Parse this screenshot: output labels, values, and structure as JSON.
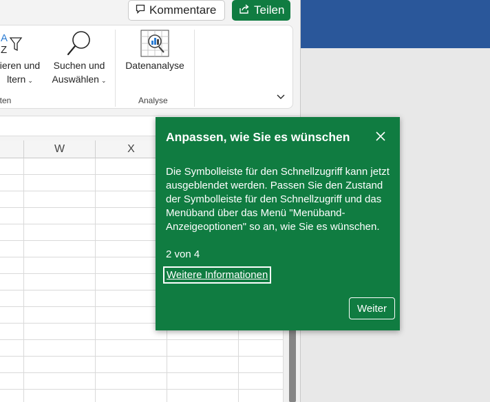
{
  "header": {
    "comment_label": "Kommentare",
    "share_label": "Teilen"
  },
  "ribbon": {
    "sort_filter": {
      "line1": "ieren und",
      "line2": "ltern"
    },
    "find_select": {
      "line1": "Suchen und",
      "line2": "Auswählen"
    },
    "data_analysis": {
      "label": "Datenanalyse"
    },
    "groups": {
      "editing": "iten",
      "analysis": "Analyse"
    }
  },
  "grid": {
    "columns": [
      "W",
      "X"
    ]
  },
  "callout": {
    "title": "Anpassen, wie Sie es wünschen",
    "body": "Die Symbolleiste für den Schnellzugriff kann jetzt ausgeblendet werden. Passen Sie den Zustand der Symbolleiste für den Schnellzugriff und das Menüband über das Menü \"Menüband-Anzeigeoptionen\" so an, wie Sie es wünschen.",
    "counter": "2 von 4",
    "link_label": "Weitere Informationen",
    "next_label": "Weiter"
  },
  "colors": {
    "accent": "#107c41",
    "title_bar": "#2a579a"
  }
}
